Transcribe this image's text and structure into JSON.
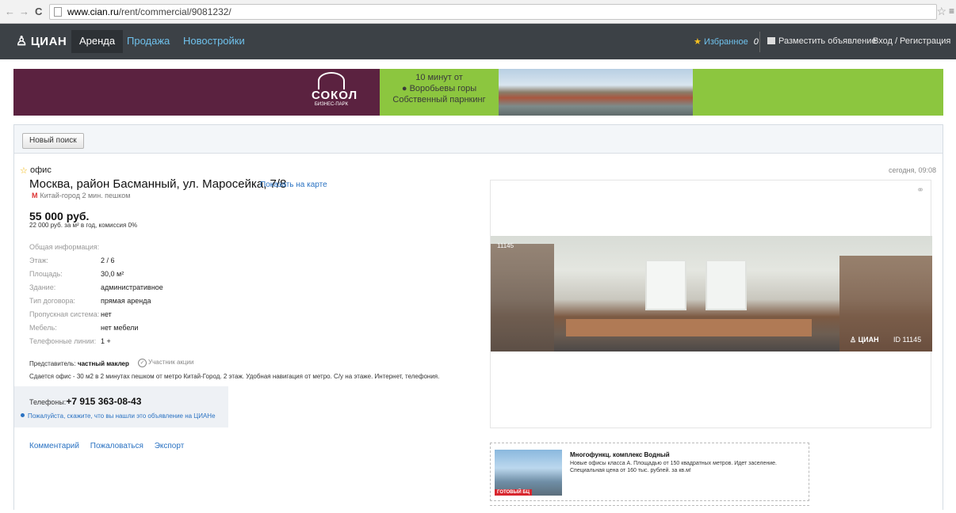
{
  "browser": {
    "back": "←",
    "forward": "→",
    "reload": "C",
    "url_host": "www.cian.ru",
    "url_path": "/rent/commercial/9081232/"
  },
  "header": {
    "logo": "ЦИАН",
    "tabs": [
      {
        "label": "Аренда",
        "active": true
      },
      {
        "label": "Продажа",
        "active": false
      },
      {
        "label": "Новостройки",
        "active": false
      }
    ],
    "favorites_label": "Избранное",
    "favorites_count": "0",
    "post_ad": "Разместить объявление",
    "login": "Вход / Регистрация"
  },
  "banner": {
    "logo_word": "СОКОЛ",
    "logo_sub": "БИЗНЕС-ПАРК",
    "line1": "10 минут от",
    "line2": "Воробьевы горы",
    "line3": "Собственный парнкинг"
  },
  "listing": {
    "new_search": "Новый поиск",
    "type": "офис",
    "date": "сегодня, 09:08",
    "address": "Москва, район Басманный, ул. Маросейка, 7/8",
    "map_link": "Показать на карте",
    "metro": "Китай-город 2 мин. пешком",
    "price": "55 000 руб.",
    "price_sub": "22 000 руб. за м² в год, комиссия 0%",
    "info_title": "Общая информация:",
    "props": [
      {
        "key": "Этаж:",
        "value": "2 / 6"
      },
      {
        "key": "Площадь:",
        "value": "30,0 м²"
      },
      {
        "key": "Здание:",
        "value": "административное"
      },
      {
        "key": "Тип договора:",
        "value": "прямая аренда"
      },
      {
        "key": "Пропускная система:",
        "value": "нет"
      },
      {
        "key": "Мебель:",
        "value": "нет мебели"
      },
      {
        "key": "Телефонные линии:",
        "value": "1 +"
      }
    ],
    "rep_label": "Представитель:",
    "rep_value": "частный маклер",
    "rep_badge": "Участник акции",
    "description": "Сдается офис - 30 м2 в 2 минутах пешком от метро Китай-Город. 2 этаж. Удобная навигация от метро. С/у на этаже. Интернет, телефония.",
    "phones_label": "Телефоны:",
    "phone": "+7 915 363-08-43",
    "phone_note": "Пожалуйста, скажите, что вы нашли это объявление на ЦИАНе",
    "actions": [
      "Комментарий",
      "Пожаловаться",
      "Экспорт"
    ]
  },
  "photo": {
    "id_top": "11145",
    "logo": "ЦИАН",
    "id_bottom": "ID 11145"
  },
  "ad": {
    "title": "Многофункц. комплекс Водный",
    "text": "Новые офисы класса А. Площадью от 150 квадратных метров. Идет заселение. Специальная цена от 160 тыс. рублей. за кв.м!",
    "img_label": "ГОТОВЫЙ БЦ"
  }
}
